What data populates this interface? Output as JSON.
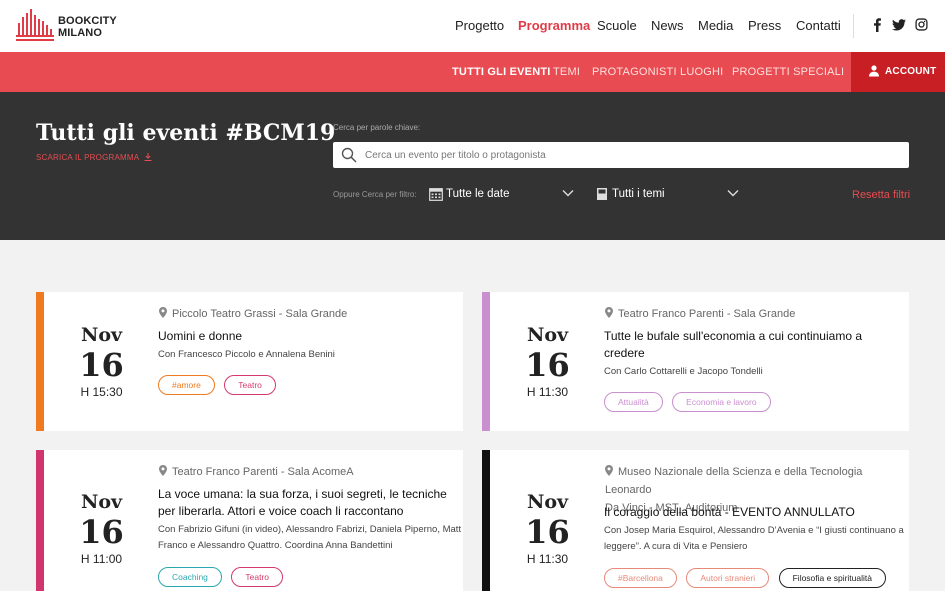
{
  "brand": {
    "logo_line1": "BOOKCITY",
    "logo_line2": "MILANO",
    "accent": "#e84b51"
  },
  "nav": {
    "items": [
      "Progetto",
      "Programma",
      "Scuole",
      "News",
      "Media",
      "Press",
      "Contatti"
    ],
    "active": "Programma",
    "social_icons": [
      "facebook-icon",
      "twitter-icon",
      "instagram-icon"
    ]
  },
  "subnav": {
    "items": [
      "TUTTI GLI EVENTI",
      "TEMI",
      "PROTAGONISTI",
      "LUOGHI",
      "PROGETTI SPECIALI"
    ],
    "active": "TUTTI GLI EVENTI",
    "account_label": "ACCOUNT"
  },
  "filters": {
    "title": "Tutti gli eventi #BCM19",
    "download_label": "SCARICA IL PROGRAMMA",
    "search_label": "Cerca per parole chiave:",
    "search_placeholder": "Cerca un evento per titolo o protagonista",
    "alt_label": "Oppure Cerca per filtro:",
    "date_filter": "Tutte le date",
    "theme_filter": "Tutti i temi",
    "reset_label": "Resetta filtri"
  },
  "events": [
    {
      "stripe_color": "#f07a1f",
      "month": "Nov",
      "day": "16",
      "hour": "H 15:30",
      "venue": "Piccolo Teatro Grassi - Sala Grande",
      "title": [
        "Uomini e donne"
      ],
      "guests": [
        "Con Francesco Piccolo e Annalena Benini"
      ],
      "tags": [
        {
          "label": "#amore",
          "color": "#f07a1f"
        },
        {
          "label": "Teatro",
          "color": "#d63a6a"
        }
      ]
    },
    {
      "stripe_color": "#c98fcf",
      "month": "Nov",
      "day": "16",
      "hour": "H 11:30",
      "venue": "Teatro Franco Parenti - Sala Grande",
      "title": [
        "Tutte le bufale sull'economia a cui continuiamo a",
        "credere"
      ],
      "guests": [
        "Con Carlo Cottarelli e Jacopo Tondelli"
      ],
      "tags": [
        {
          "label": "Attualità",
          "color": "#c98fcf"
        },
        {
          "label": "Economia e lavoro",
          "color": "#c98fcf"
        }
      ]
    },
    {
      "stripe_color": "#d1356e",
      "month": "Nov",
      "day": "16",
      "hour": "H 11:00",
      "venue": "Teatro Franco Parenti - Sala AcomeA",
      "title": [
        "La voce umana: la sua forza, i suoi segreti, le tecniche",
        "per liberarla. Attori e voice coach li raccontano"
      ],
      "guests": [
        "Con Fabrizio Gifuni (in video), Alessandro Fabrizi, Daniela Piperno, Matt",
        "Franco e Alessandro Quattro. Coordina Anna Bandettini"
      ],
      "tags": [
        {
          "label": "Coaching",
          "color": "#2aa8b0"
        },
        {
          "label": "Teatro",
          "color": "#d63a6a"
        }
      ]
    },
    {
      "stripe_color": "#111111",
      "month": "Nov",
      "day": "16",
      "hour": "H 11:30",
      "venue": [
        "Museo Nazionale della Scienza e della Tecnologia Leonardo",
        "Da Vinci - MST_Auditorium"
      ],
      "title": [
        "Il coraggio della bontà - EVENTO ANNULLATO"
      ],
      "guests": [
        "Con Josep Maria Esquirol, Alessandro D’Avenia e “I giusti continuano a",
        "leggere”. A cura di Vita e Pensiero"
      ],
      "tags": [
        {
          "label": "#Barcellona",
          "color": "#e88a7a"
        },
        {
          "label": "Autori stranieri",
          "color": "#e88a7a"
        },
        {
          "label": "Filosofia e spiritualità",
          "color": "#222222"
        }
      ]
    }
  ]
}
